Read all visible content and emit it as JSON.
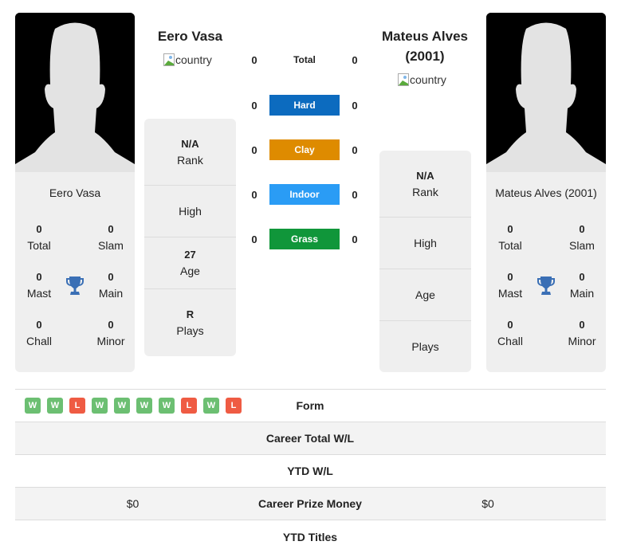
{
  "player1": {
    "name": "Eero Vasa",
    "country_alt": "country",
    "titles": {
      "total": {
        "value": "0",
        "label": "Total"
      },
      "slam": {
        "value": "0",
        "label": "Slam"
      },
      "mast": {
        "value": "0",
        "label": "Mast"
      },
      "main": {
        "value": "0",
        "label": "Main"
      },
      "chall": {
        "value": "0",
        "label": "Chall"
      },
      "minor": {
        "value": "0",
        "label": "Minor"
      }
    },
    "info": {
      "rank": {
        "value": "N/A",
        "label": "Rank"
      },
      "high": {
        "value": "",
        "label": "High"
      },
      "age": {
        "value": "27",
        "label": "Age"
      },
      "plays": {
        "value": "R",
        "label": "Plays"
      }
    }
  },
  "player2": {
    "name": "Mateus Alves (2001)",
    "heading_line1": "Mateus Alves",
    "heading_line2": "(2001)",
    "country_alt": "country",
    "titles": {
      "total": {
        "value": "0",
        "label": "Total"
      },
      "slam": {
        "value": "0",
        "label": "Slam"
      },
      "mast": {
        "value": "0",
        "label": "Mast"
      },
      "main": {
        "value": "0",
        "label": "Main"
      },
      "chall": {
        "value": "0",
        "label": "Chall"
      },
      "minor": {
        "value": "0",
        "label": "Minor"
      }
    },
    "info": {
      "rank": {
        "value": "N/A",
        "label": "Rank"
      },
      "high": {
        "value": "",
        "label": "High"
      },
      "age": {
        "value": "",
        "label": "Age"
      },
      "plays": {
        "value": "",
        "label": "Plays"
      }
    }
  },
  "surfaces": [
    {
      "label": "Total",
      "p1": "0",
      "p2": "0",
      "color": ""
    },
    {
      "label": "Hard",
      "p1": "0",
      "p2": "0",
      "color": "#0c6bbf"
    },
    {
      "label": "Clay",
      "p1": "0",
      "p2": "0",
      "color": "#de8b00"
    },
    {
      "label": "Indoor",
      "p1": "0",
      "p2": "0",
      "color": "#2a9cf5"
    },
    {
      "label": "Grass",
      "p1": "0",
      "p2": "0",
      "color": "#10963a"
    }
  ],
  "form": [
    "W",
    "W",
    "L",
    "W",
    "W",
    "W",
    "W",
    "L",
    "W",
    "L"
  ],
  "form_colors": {
    "W": "#6cbf72",
    "L": "#ef5b43"
  },
  "stats": [
    {
      "label": "Form",
      "p1": "",
      "p2": ""
    },
    {
      "label": "Career Total W/L",
      "p1": "",
      "p2": ""
    },
    {
      "label": "YTD W/L",
      "p1": "",
      "p2": ""
    },
    {
      "label": "Career Prize Money",
      "p1": "$0",
      "p2": "$0"
    },
    {
      "label": "YTD Titles",
      "p1": "",
      "p2": ""
    }
  ],
  "colors": {
    "trophy": "#3a6fb5",
    "panel": "#efefef"
  }
}
